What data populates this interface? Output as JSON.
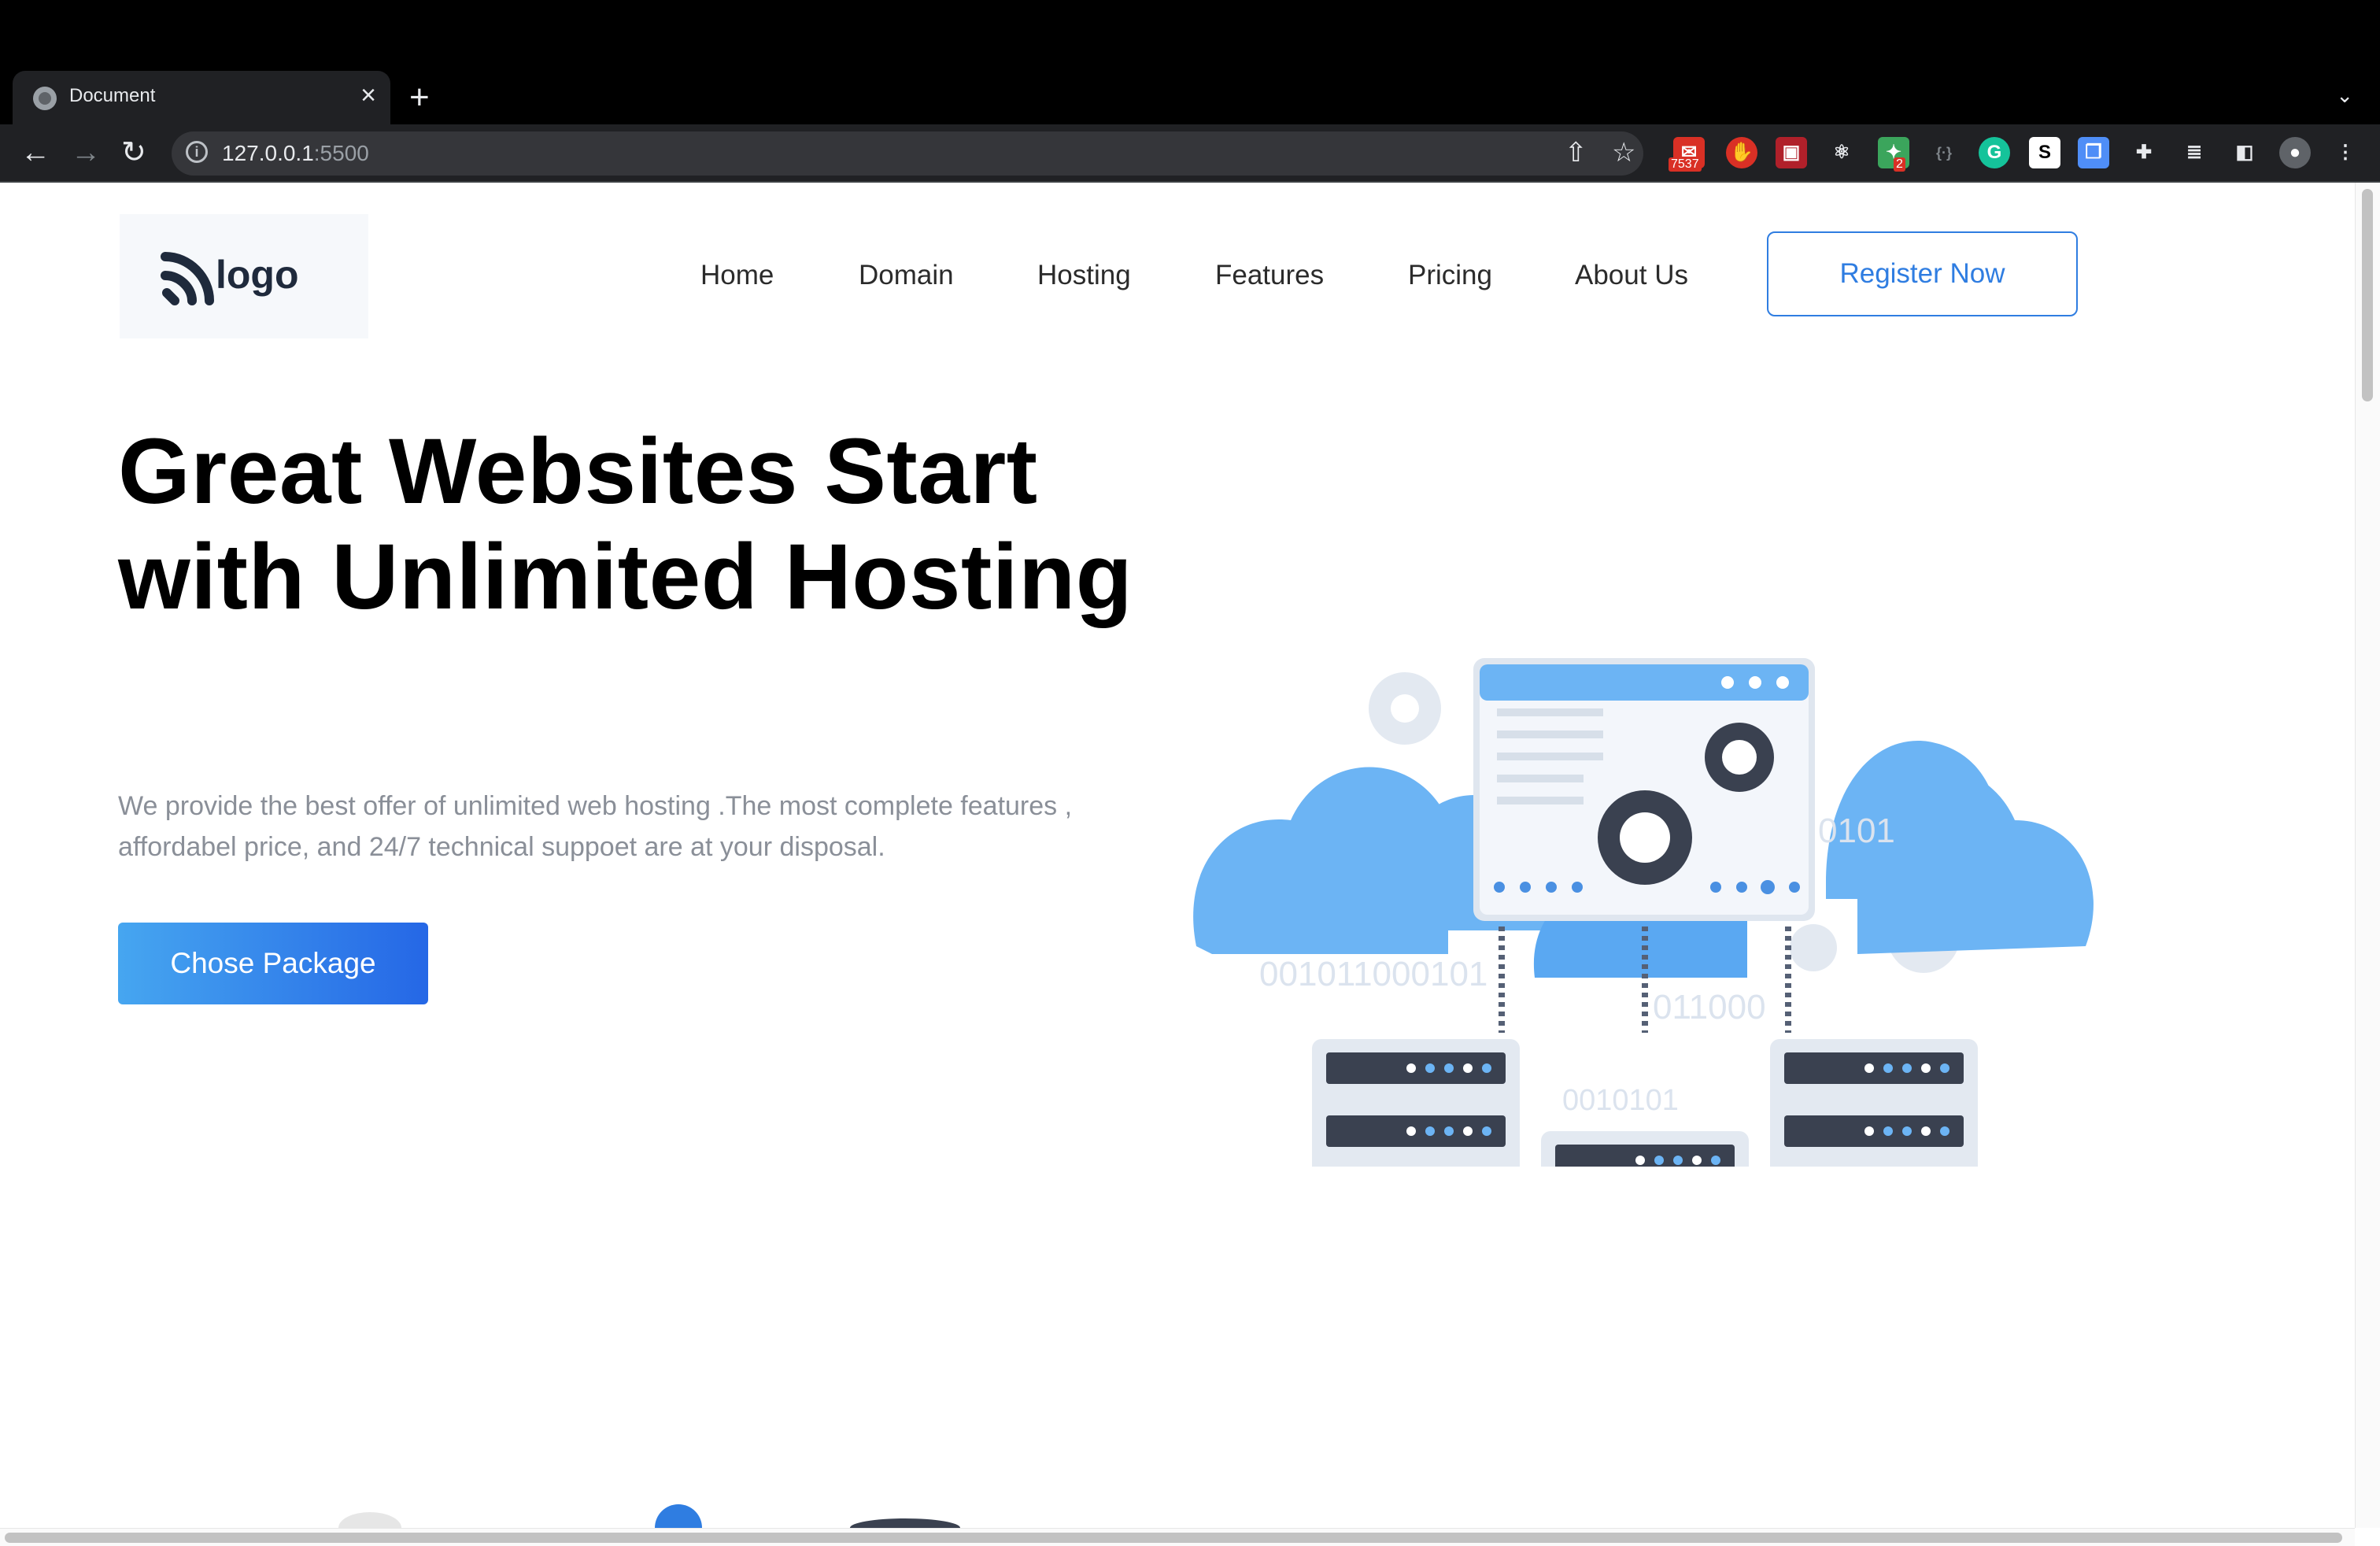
{
  "browser": {
    "tab_title": "Document",
    "new_tab": "+",
    "url_host": "127.0.0.1",
    "url_port": ":5500",
    "extensions": {
      "mail_badge": "7537",
      "ext_badge": "2",
      "ext_s_label": "S",
      "ext_g_label": "G"
    }
  },
  "site": {
    "logo_text": "logo",
    "nav": [
      "Home",
      "Domain",
      "Hosting",
      "Features",
      "Pricing",
      "About Us"
    ],
    "register_label": "Register Now",
    "hero_title": "Great Websites Start with Unlimited Hosting",
    "hero_desc": "We provide the best offer of unlimited web hosting .The most complete features , affordabel price, and 24/7 technical suppoet are at your disposal.",
    "cta_label": "Chose Package",
    "illustration_text": {
      "binary_1": "0101",
      "binary_2": "001011000101",
      "binary_3": "011000",
      "binary_4": "0010101"
    }
  },
  "colors": {
    "accent": "#2f7de1",
    "cta_start": "#46a6f0",
    "cta_end": "#2567e6",
    "cloud": "#6cb4f4",
    "server_dark": "#3a4150"
  }
}
